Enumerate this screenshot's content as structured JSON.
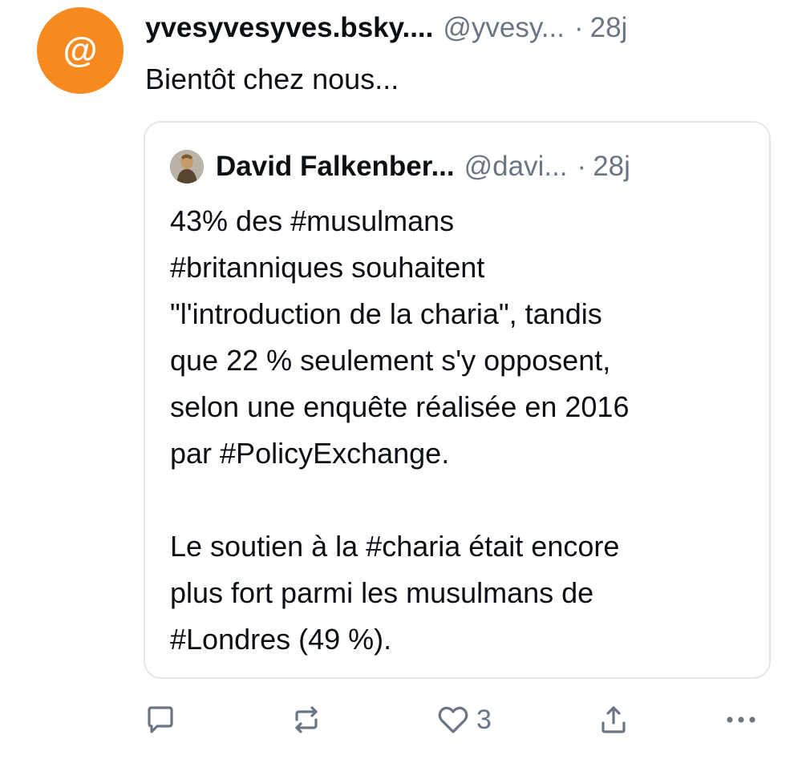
{
  "post": {
    "avatar_glyph": "@",
    "avatar_color": "#f68a1e",
    "author": "yvesyvesyves.bsky....",
    "handle": "@yvesy...",
    "separator": "·",
    "time": "28j",
    "text": "Bientôt chez nous..."
  },
  "quote": {
    "author": "David Falkenber...",
    "handle": "@davi...",
    "separator": "·",
    "time": "28j",
    "paragraph1_lines": [
      "43% des #musulmans",
      "#britanniques souhaitent",
      "\"l'introduction de la charia\", tandis",
      "que 22 % seulement s'y opposent,",
      "selon une enquête réalisée en 2016",
      "par #PolicyExchange."
    ],
    "paragraph2_lines": [
      "Le soutien à la #charia était encore",
      "plus fort parmi les musulmans de",
      "#Londres (49 %)."
    ]
  },
  "actions": {
    "reply_icon": "comment-icon",
    "repost_icon": "repost-icon",
    "like_icon": "heart-icon",
    "like_count": "3",
    "share_icon": "share-icon",
    "more_icon": "more-icon"
  },
  "colors": {
    "text": "#0b0f14",
    "muted": "#6a7683",
    "border": "#e3e7eb"
  }
}
